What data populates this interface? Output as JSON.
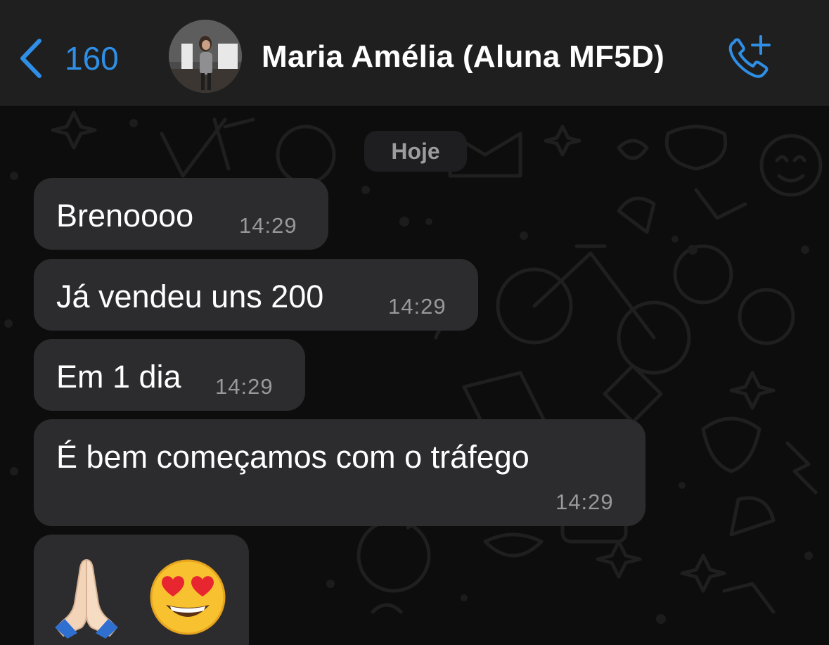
{
  "header": {
    "back_count": "160",
    "contact_name": "Maria Amélia (Aluna MF5D)",
    "back_icon": "chevron-left-icon",
    "call_icon": "phone-add-icon",
    "accent_color": "#2f8fe6"
  },
  "chat": {
    "date_label": "Hoje",
    "messages": [
      {
        "text": "Brenoooo",
        "time": "14:29"
      },
      {
        "text": "Já vendeu uns 200",
        "time": "14:29"
      },
      {
        "text": "Em 1 dia",
        "time": "14:29"
      },
      {
        "text": "É bem começamos com o tráfego",
        "time": "14:29"
      },
      {
        "text": "🙏🏻 😍",
        "emoji_names": [
          "folded-hands-emoji",
          "heart-eyes-emoji"
        ]
      }
    ],
    "bubble_color": "#2c2c2e",
    "background_color": "#0d0d0d"
  }
}
